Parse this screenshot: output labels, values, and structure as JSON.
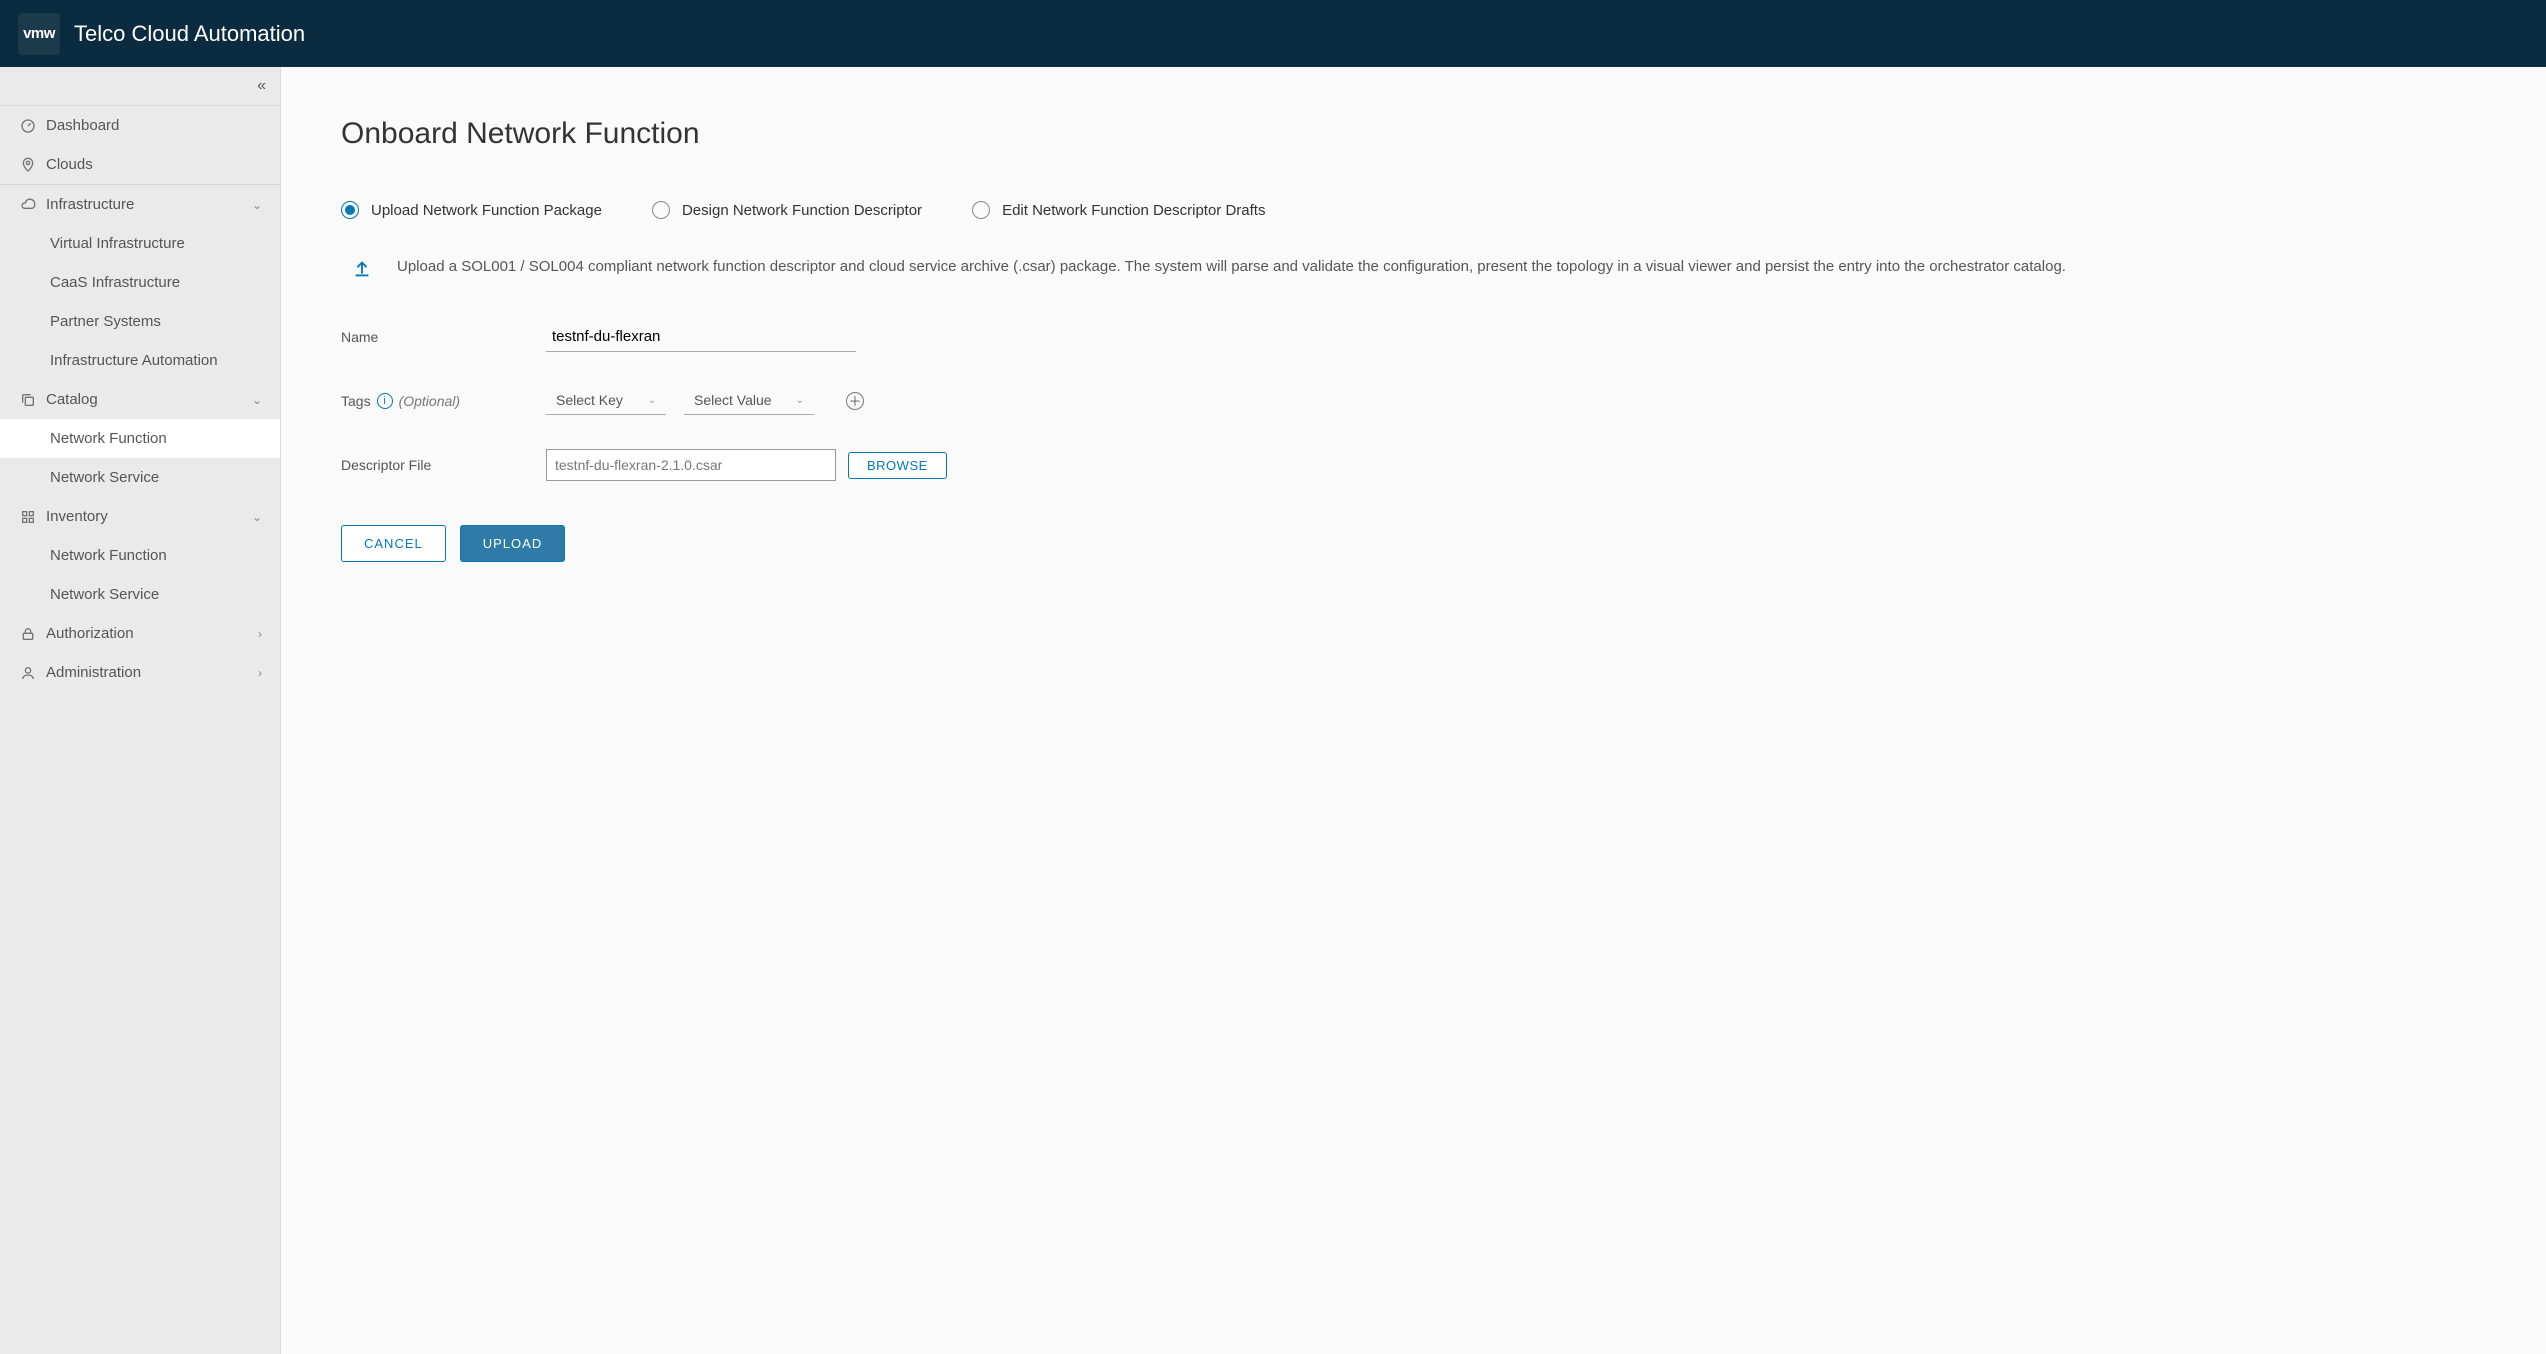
{
  "header": {
    "logo_text": "vmw",
    "app_title": "Telco Cloud Automation"
  },
  "sidebar": {
    "top": [
      {
        "icon": "gauge",
        "label": "Dashboard"
      },
      {
        "icon": "pin",
        "label": "Clouds"
      }
    ],
    "groups": [
      {
        "icon": "cloud",
        "label": "Infrastructure",
        "expanded": true,
        "items": [
          {
            "label": "Virtual Infrastructure"
          },
          {
            "label": "CaaS Infrastructure"
          },
          {
            "label": "Partner Systems"
          },
          {
            "label": "Infrastructure Automation"
          }
        ]
      },
      {
        "icon": "stack",
        "label": "Catalog",
        "expanded": true,
        "items": [
          {
            "label": "Network Function",
            "active": true
          },
          {
            "label": "Network Service"
          }
        ]
      },
      {
        "icon": "grid",
        "label": "Inventory",
        "expanded": true,
        "items": [
          {
            "label": "Network Function"
          },
          {
            "label": "Network Service"
          }
        ]
      },
      {
        "icon": "lock",
        "label": "Authorization",
        "expanded": false,
        "items": []
      },
      {
        "icon": "user",
        "label": "Administration",
        "expanded": false,
        "items": []
      }
    ]
  },
  "main": {
    "page_title": "Onboard Network Function",
    "radios": [
      {
        "label": "Upload Network Function Package",
        "selected": true
      },
      {
        "label": "Design Network Function Descriptor",
        "selected": false
      },
      {
        "label": "Edit Network Function Descriptor Drafts",
        "selected": false
      }
    ],
    "description": "Upload a SOL001 / SOL004 compliant network function descriptor and cloud service archive (.csar) package. The system will parse and validate the configuration, present the topology in a visual viewer and persist the entry into the orchestrator catalog.",
    "form": {
      "name_label": "Name",
      "name_value": "testnf-du-flexran",
      "tags_label": "Tags",
      "tags_optional": "(Optional)",
      "select_key_placeholder": "Select Key",
      "select_value_placeholder": "Select Value",
      "descriptor_label": "Descriptor File",
      "descriptor_filename": "testnf-du-flexran-2.1.0.csar",
      "browse_label": "BROWSE"
    },
    "actions": {
      "cancel": "CANCEL",
      "upload": "UPLOAD"
    }
  }
}
